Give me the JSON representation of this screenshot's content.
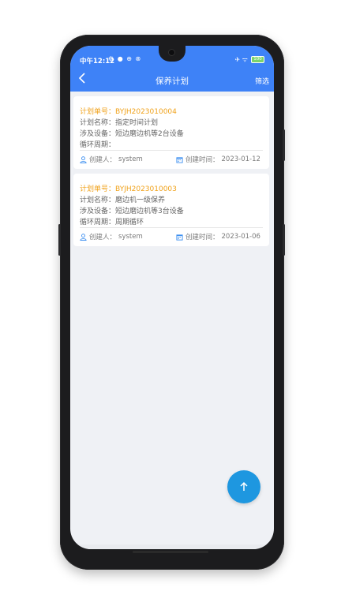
{
  "status_bar": {
    "time": "中午12:12",
    "left_icons": "⚙ ● ⊕ ⊗",
    "right_icons": "✈ ᯤ",
    "battery": "100"
  },
  "header": {
    "title": "保养计划",
    "filter_label": "筛选"
  },
  "plans": [
    {
      "number_label": "计划单号：",
      "number": "BYJH2023010004",
      "name_label": "计划名称：",
      "name": "指定时间计划",
      "equipment_label": "涉及设备：",
      "equipment": "短边磨边机等2台设备",
      "cycle_label": "循环周期：",
      "cycle": "",
      "creator_label": "创建人：",
      "creator": "system",
      "created_label": "创建时间：",
      "created": "2023-01-12"
    },
    {
      "number_label": "计划单号：",
      "number": "BYJH2023010003",
      "name_label": "计划名称：",
      "name": "磨边机一级保养",
      "equipment_label": "涉及设备：",
      "equipment": "短边磨边机等3台设备",
      "cycle_label": "循环周期：",
      "cycle": "周期循环",
      "creator_label": "创建人：",
      "creator": "system",
      "created_label": "创建时间：",
      "created": "2023-01-06"
    }
  ],
  "colors": {
    "primary": "#3e82f7",
    "accent_orange": "#f0a21b",
    "fab": "#1e97e0",
    "background": "#eff1f5",
    "icon_blue": "#3d8ff0"
  },
  "icons": {
    "back": "chevron-left-icon",
    "user": "user-icon",
    "calendar": "calendar-icon",
    "fab": "arrow-up-icon"
  }
}
